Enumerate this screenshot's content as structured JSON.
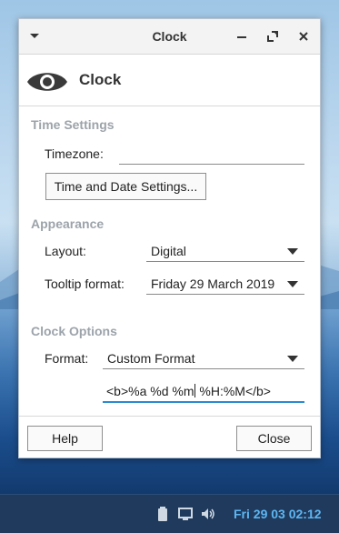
{
  "window": {
    "title": "Clock",
    "menu_icon": "chevron-down-icon",
    "minimize_icon": "minimize-icon",
    "maximize_icon": "maximize-icon",
    "close_icon": "close-icon"
  },
  "header": {
    "title": "Clock",
    "icon": "eye-icon"
  },
  "time_settings": {
    "title": "Time Settings",
    "timezone_label": "Timezone:",
    "timezone_value": "",
    "datetime_button": "Time and Date Settings..."
  },
  "appearance": {
    "title": "Appearance",
    "layout_label": "Layout:",
    "layout_value": "Digital",
    "tooltip_label": "Tooltip format:",
    "tooltip_value": "Friday 29 March 2019"
  },
  "clock_options": {
    "title": "Clock Options",
    "format_label": "Format:",
    "format_value": "Custom Format",
    "custom_before_caret": "<b>%a %d %m",
    "custom_after_caret": " %H:%M</b>"
  },
  "footer": {
    "help": "Help",
    "close": "Close"
  },
  "panel": {
    "icons": [
      "battery-icon",
      "display-icon",
      "volume-icon"
    ],
    "clock": "Fri 29 03 02:12"
  },
  "colors": {
    "accent": "#2a8bd0",
    "panel": "#1f3a5c",
    "panel_clock": "#5eb6f2",
    "section": "#9ca3aa"
  }
}
